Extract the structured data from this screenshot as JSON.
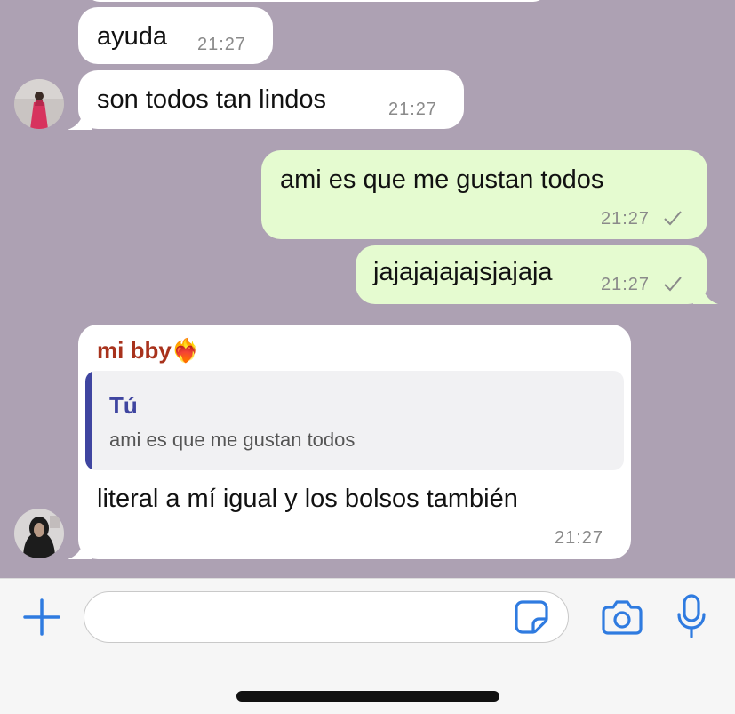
{
  "messages": [
    {
      "direction": "incoming",
      "text": "ayuda",
      "time": "21:27"
    },
    {
      "direction": "incoming",
      "text": "son todos tan lindos",
      "time": "21:27",
      "avatar": "contact-avatar"
    },
    {
      "direction": "outgoing",
      "text": "ami es que me gustan todos",
      "time": "21:27",
      "status": "sent-check-icon"
    },
    {
      "direction": "outgoing",
      "text": "jajajajajajsjajaja",
      "time": "21:27",
      "status": "sent-check-icon"
    },
    {
      "direction": "incoming",
      "sender": "mi bby❤️‍🔥",
      "quote": {
        "author": "Tú",
        "text": "ami es que me gustan todos"
      },
      "text": "literal a mí igual y los bolsos también",
      "time": "21:27",
      "avatar": "contact-avatar"
    }
  ],
  "composer": {
    "input_value": "",
    "icons": [
      "plus-icon",
      "sticker-icon",
      "camera-icon",
      "microphone-icon"
    ]
  },
  "colors": {
    "chat_background": "#ada1b3",
    "incoming_bubble": "#ffffff",
    "outgoing_bubble": "#e5fbd0",
    "sender_name": "#a8321c",
    "quote_accent": "#3f45a0",
    "icon_blue": "#2f7be0"
  }
}
